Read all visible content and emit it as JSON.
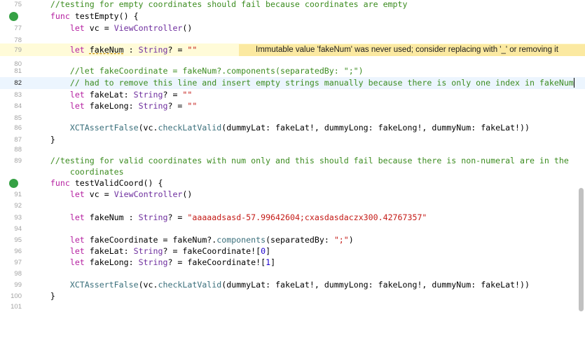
{
  "gutter": [
    "75",
    "76",
    "77",
    "78",
    "79",
    "80",
    "81",
    "82",
    "83",
    "84",
    "85",
    "86",
    "87",
    "88",
    "89",
    "",
    "90",
    "91",
    "92",
    "93",
    "94",
    "95",
    "96",
    "97",
    "98",
    "99",
    "100",
    "101"
  ],
  "code": {
    "l75": "//testing for empty coordinates should fail because coordinates are empty",
    "l76_kw": "func",
    "l76_name": " testEmpty() {",
    "l77_kw": "let",
    "l77_a": " vc = ",
    "l77_ty": "ViewController",
    "l77_b": "()",
    "l79_kw": "let",
    "l79_var": "fakeNum",
    "l79_a": " : ",
    "l79_ty": "String",
    "l79_b": "? = ",
    "l79_str": "\"\"",
    "l81": "//let fakeCoordinate = fakeNum?.components(separatedBy: \";\")",
    "l82": "// had to remove this line and insert empty strings manually because there is only one index in fakeNum",
    "l83_kw": "let",
    "l83_a": " fakeLat: ",
    "l83_ty": "String",
    "l83_b": "? = ",
    "l83_str": "\"\"",
    "l84_kw": "let",
    "l84_a": " fakeLong: ",
    "l84_ty": "String",
    "l84_b": "? = ",
    "l84_str": "\"\"",
    "l86_fn": "XCTAssertFalse",
    "l86_a": "(vc.",
    "l86_fn2": "checkLatValid",
    "l86_b": "(dummyLat: fakeLat!, dummyLong: fakeLong!, dummyNum: fakeLat!))",
    "l87": "}",
    "l89": "//testing for valid coordinates with num only and this should fail because there is non-numeral are in the",
    "l89b": "    coordinates",
    "l90_kw": "func",
    "l90_name": " testValidCoord() {",
    "l91_kw": "let",
    "l91_a": " vc = ",
    "l91_ty": "ViewController",
    "l91_b": "()",
    "l93_kw": "let",
    "l93_a": " fakeNum : ",
    "l93_ty": "String",
    "l93_b": "? = ",
    "l93_str": "\"aaaaadsasd-57.99642604;cxasdasdaczx300.42767357\"",
    "l95_kw": "let",
    "l95_a": " fakeCoordinate = fakeNum?.",
    "l95_fn": "components",
    "l95_b": "(separatedBy: ",
    "l95_str": "\";\"",
    "l95_c": ")",
    "l96_kw": "let",
    "l96_a": " fakeLat: ",
    "l96_ty": "String",
    "l96_b": "? = fakeCoordinate![",
    "l96_num": "0",
    "l96_c": "]",
    "l97_kw": "let",
    "l97_a": " fakeLong: ",
    "l97_ty": "String",
    "l97_b": "? = fakeCoordinate![",
    "l97_num": "1",
    "l97_c": "]",
    "l99_fn": "XCTAssertFalse",
    "l99_a": "(vc.",
    "l99_fn2": "checkLatValid",
    "l99_b": "(dummyLat: fakeLat!, dummyLong: fakeLong!, dummyNum: fakeLat!))",
    "l100": "}"
  },
  "warning": {
    "icon": "warning-triangle-icon",
    "message": "Immutable value 'fakeNum' was never used; consider replacing with '_' or removing it"
  },
  "test_status_icon": "test-passed-icon",
  "colors": {
    "keyword": "#b51fa0",
    "type": "#6e2e9e",
    "string": "#c41a16",
    "comment": "#3c8c20",
    "number": "#1c00cf",
    "warning_bg": "#fbe9a1",
    "current_line_bg": "#ecf5fe",
    "test_pass": "#35a144"
  }
}
